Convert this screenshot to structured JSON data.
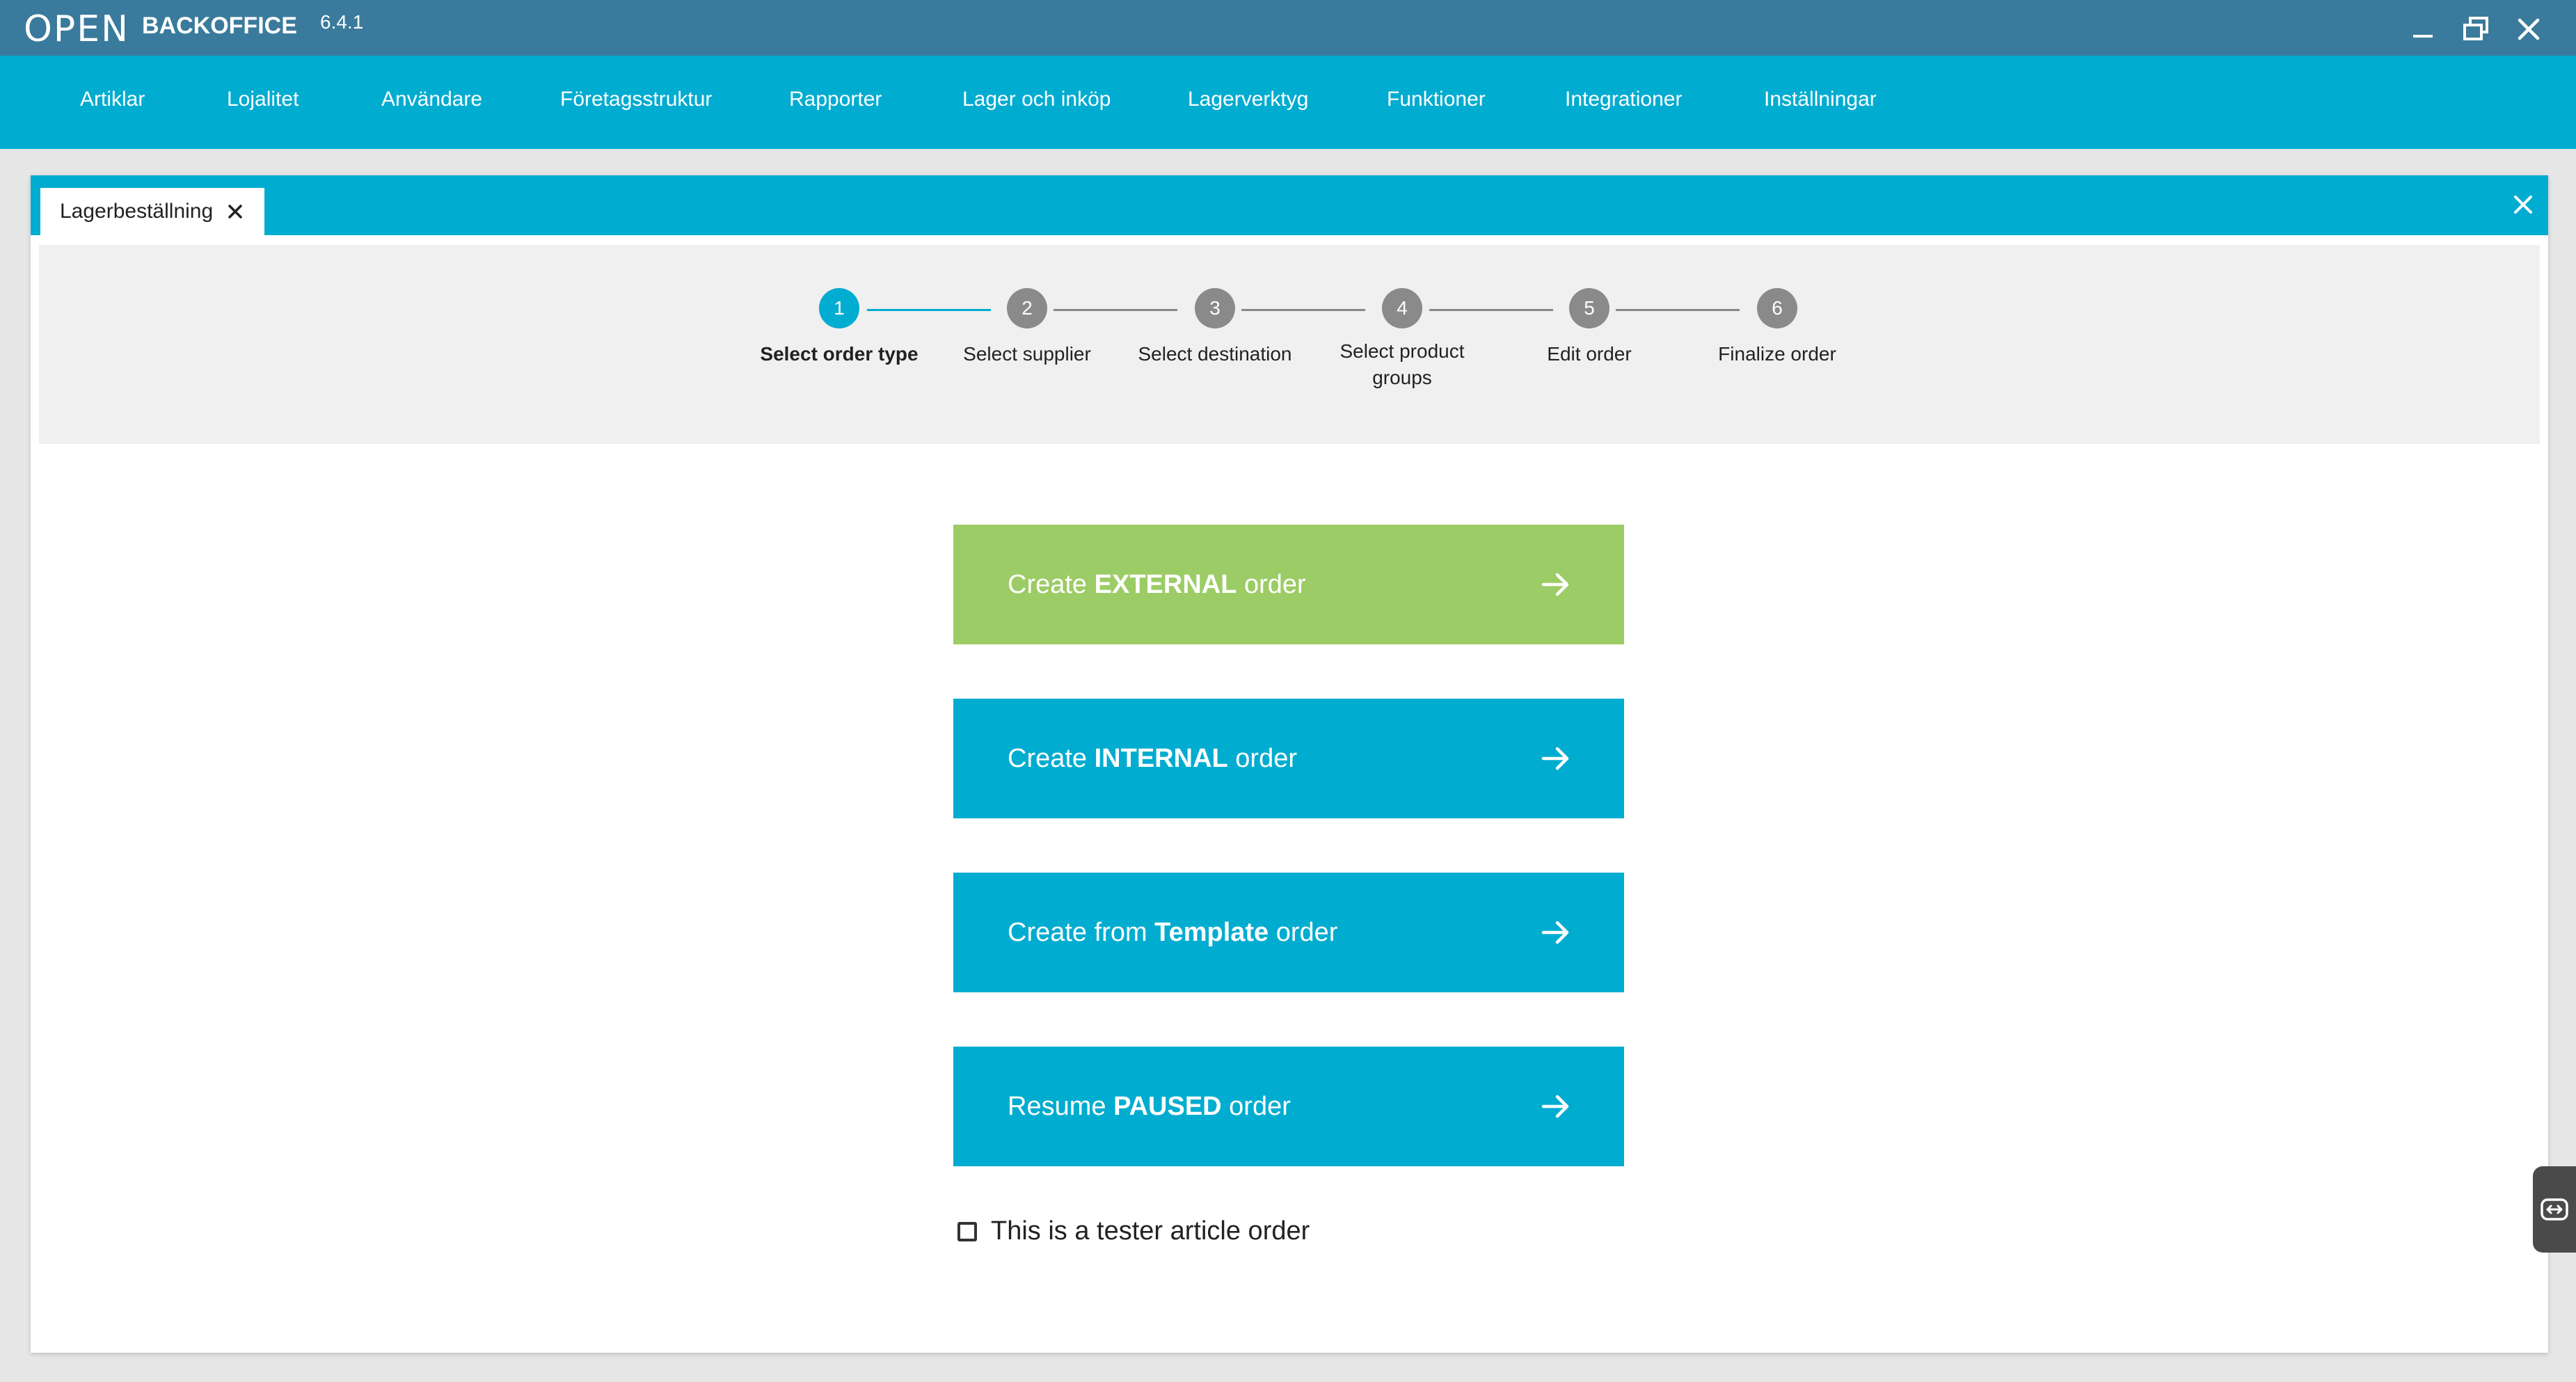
{
  "app": {
    "logo_text": "OPEN",
    "name": "BACKOFFICE",
    "version": "6.4.1",
    "accent_color": "#00acd0",
    "titlebar_color": "#3a7a9c"
  },
  "window_controls": [
    "minimize-icon",
    "restore-icon",
    "close-icon"
  ],
  "menu": {
    "items": [
      {
        "label": "Artiklar"
      },
      {
        "label": "Lojalitet"
      },
      {
        "label": "Användare"
      },
      {
        "label": "Företagsstruktur"
      },
      {
        "label": "Rapporter"
      },
      {
        "label": "Lager och inköp"
      },
      {
        "label": "Lagerverktyg"
      },
      {
        "label": "Funktioner"
      },
      {
        "label": "Integrationer"
      },
      {
        "label": "Inställningar"
      }
    ]
  },
  "document_tab": {
    "label": "Lagerbeställning"
  },
  "wizard": {
    "current_step": 1,
    "steps": [
      {
        "number": "1",
        "label": "Select order type"
      },
      {
        "number": "2",
        "label": "Select supplier"
      },
      {
        "number": "3",
        "label": "Select destination"
      },
      {
        "number": "4",
        "label": "Select product groups"
      },
      {
        "number": "5",
        "label": "Edit order"
      },
      {
        "number": "6",
        "label": "Finalize order"
      }
    ]
  },
  "actions": [
    {
      "prefix": "Create ",
      "bold": "EXTERNAL",
      "suffix": " order",
      "color": "#9ccc65"
    },
    {
      "prefix": "Create ",
      "bold": "INTERNAL",
      "suffix": " order",
      "color": "#00acd0"
    },
    {
      "prefix": "Create from ",
      "bold": "Template",
      "suffix": " order",
      "color": "#00acd0"
    },
    {
      "prefix": "Resume ",
      "bold": "PAUSED",
      "suffix": " order",
      "color": "#00acd0"
    }
  ],
  "tester_checkbox": {
    "label": "This is a tester article order",
    "checked": false
  }
}
